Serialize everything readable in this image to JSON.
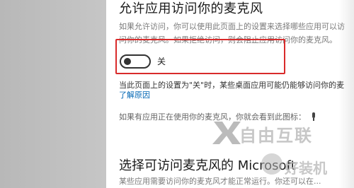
{
  "section": {
    "title": "允许应用访问你的麦克风",
    "description": "如果允许访问，你可以使用此页面上的设置来选择哪些应用可以访问你的麦克风。如果拒绝访问，则会阻止应用访问你的麦克风。"
  },
  "toggle": {
    "state": "off",
    "label": "关"
  },
  "note": "当此页面上的设置为\"关\"时，某些桌面应用可能仍能够访问你的麦",
  "link": "了解原因",
  "icon_line": {
    "text": "如果有应用正在使用你的麦克风，你就会看到此图标："
  },
  "section2": {
    "title": "选择可访问麦克风的 Microsoft",
    "description": "某些应用需要访问你的麦克风才能正常运行。你还可以在..."
  },
  "watermarks": {
    "brand1": "自由互联",
    "brand2": "好装机"
  },
  "colors": {
    "highlight_frame": "#d92b2b",
    "link": "#0066b4",
    "background_left": "#bdbdbd"
  }
}
